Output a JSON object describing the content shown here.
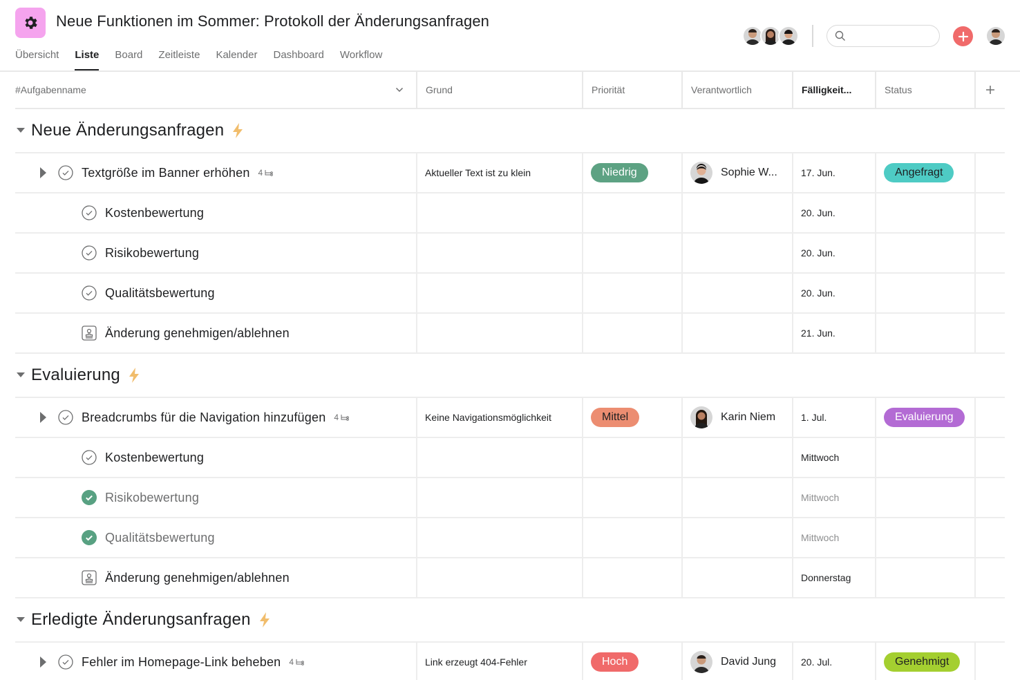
{
  "header": {
    "project_icon": "gear-icon",
    "project_icon_color": "#f5a4ee",
    "title": "Neue Funktionen im Sommer: Protokoll der Änderungsanfragen",
    "tabs": [
      {
        "label": "Übersicht",
        "active": false
      },
      {
        "label": "Liste",
        "active": true
      },
      {
        "label": "Board",
        "active": false
      },
      {
        "label": "Zeitleiste",
        "active": false
      },
      {
        "label": "Kalender",
        "active": false
      },
      {
        "label": "Dashboard",
        "active": false
      },
      {
        "label": "Workflow",
        "active": false
      }
    ],
    "search": {
      "placeholder": "",
      "value": ""
    },
    "add_button_color": "#f06a6a"
  },
  "columns": {
    "name": "#Aufgabenname",
    "grund": "Grund",
    "prio": "Priorität",
    "owner": "Verantwortlich",
    "due": "Fälligkeit...",
    "status": "Status",
    "add": "+"
  },
  "sections": [
    {
      "title": "Neue Änderungsanfragen",
      "tasks": [
        {
          "name": "Textgröße im Banner erhöhen",
          "subtasks": "4",
          "grund": "Aktueller Text ist zu klein",
          "prio": "Niedrig",
          "owner": "Sophie W...",
          "due": "17. Jun.",
          "status": "Angefragt"
        },
        {
          "name": "Kostenbewertung",
          "due": "20. Jun."
        },
        {
          "name": "Risikobewertung",
          "due": "20. Jun."
        },
        {
          "name": "Qualitätsbewertung",
          "due": "20. Jun."
        },
        {
          "name": "Änderung genehmigen/ablehnen",
          "due": "21. Jun."
        }
      ]
    },
    {
      "title": "Evaluierung",
      "tasks": [
        {
          "name": "Breadcrumbs für die Navigation hinzufügen",
          "subtasks": "4",
          "grund": "Keine Navigationsmöglichkeit",
          "prio": "Mittel",
          "owner": "Karin Niem",
          "due": "1. Jul.",
          "status": "Evaluierung"
        },
        {
          "name": "Kostenbewertung",
          "due": "Mittwoch"
        },
        {
          "name": "Risikobewertung",
          "due": "Mittwoch",
          "completed": true
        },
        {
          "name": "Qualitätsbewertung",
          "due": "Mittwoch",
          "completed": true
        },
        {
          "name": "Änderung genehmigen/ablehnen",
          "due": "Donnerstag"
        }
      ]
    },
    {
      "title": "Erledigte Änderungsanfragen",
      "tasks": [
        {
          "name": "Fehler im Homepage-Link beheben",
          "subtasks": "4",
          "grund": "Link erzeugt 404-Fehler",
          "prio": "Hoch",
          "owner": "David Jung",
          "due": "20. Jul.",
          "status": "Genehmigt"
        }
      ]
    }
  ],
  "colors": {
    "prio_niedrig": "#5da283",
    "prio_mittel": "#ec8d71",
    "prio_hoch": "#f06a6a",
    "status_angefragt": "#4ecbc4",
    "status_evaluierung": "#b36bd4",
    "status_genehmigt": "#a4cf30",
    "completed_check": "#58a182",
    "bolt": "#f1bd6c"
  }
}
